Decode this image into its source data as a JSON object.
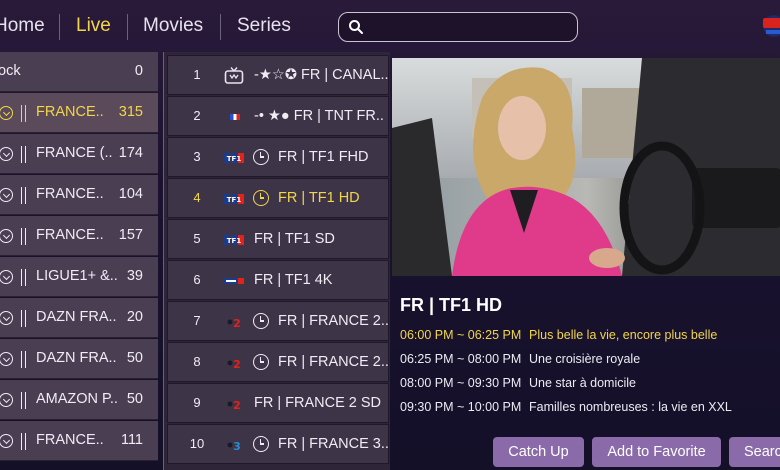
{
  "nav": {
    "tabs": [
      {
        "label": "Home"
      },
      {
        "label": "Live"
      },
      {
        "label": "Movies"
      },
      {
        "label": "Series"
      }
    ],
    "active_tab": "Live",
    "search": {
      "value": "",
      "placeholder": ""
    }
  },
  "categories": [
    {
      "name": "ock",
      "count": "0"
    },
    {
      "name": "FRANCE..",
      "count": "315"
    },
    {
      "name": "FRANCE (..",
      "count": "174"
    },
    {
      "name": "FRANCE..",
      "count": "104"
    },
    {
      "name": "FRANCE..",
      "count": "157"
    },
    {
      "name": "LIGUE1+ &..",
      "count": "39"
    },
    {
      "name": "DAZN FRA..",
      "count": "20"
    },
    {
      "name": "DAZN FRA..",
      "count": "50"
    },
    {
      "name": "AMAZON P..",
      "count": "50"
    },
    {
      "name": "FRANCE..",
      "count": "111"
    }
  ],
  "channels": [
    {
      "num": "1",
      "name": "-★☆✪ FR | CANAL..",
      "has_catchup": false,
      "logo": "tv-icon"
    },
    {
      "num": "2",
      "name": "-• ★● FR | TNT FR..",
      "has_catchup": false,
      "logo": "france-flag-icon"
    },
    {
      "num": "3",
      "name": "FR | TF1 FHD",
      "has_catchup": true,
      "logo": "tf1-logo"
    },
    {
      "num": "4",
      "name": "FR | TF1 HD",
      "has_catchup": true,
      "logo": "tf1-logo"
    },
    {
      "num": "5",
      "name": "FR | TF1 SD",
      "has_catchup": false,
      "logo": "tf1-logo"
    },
    {
      "num": "6",
      "name": "FR | TF1 4K",
      "has_catchup": false,
      "logo": "tf1-4k-logo"
    },
    {
      "num": "7",
      "name": "FR | FRANCE 2..",
      "has_catchup": true,
      "logo": "france2-logo"
    },
    {
      "num": "8",
      "name": "FR | FRANCE 2..",
      "has_catchup": true,
      "logo": "france2-logo"
    },
    {
      "num": "9",
      "name": "FR | FRANCE 2 SD",
      "has_catchup": false,
      "logo": "france2-logo"
    },
    {
      "num": "10",
      "name": "FR | FRANCE 3..",
      "has_catchup": true,
      "logo": "france3-logo"
    }
  ],
  "selected_channel": "4",
  "player": {
    "channel_title": "FR | TF1 HD",
    "epg": [
      {
        "time": "06:00 PM ~ 06:25 PM",
        "title": "Plus belle la vie, encore plus belle",
        "current": true
      },
      {
        "time": "06:25 PM ~ 08:00 PM",
        "title": "Une croisière royale",
        "current": false
      },
      {
        "time": "08:00 PM ~ 09:30 PM",
        "title": "Une star à domicile",
        "current": false
      },
      {
        "time": "09:30 PM ~ 10:00 PM",
        "title": "Familles nombreuses : la vie en XXL",
        "current": false
      }
    ]
  },
  "actions": {
    "catch_up": "Catch Up",
    "add_favorite": "Add to Favorite",
    "search": "Searc"
  },
  "colors": {
    "accent_yellow": "#f2d64a",
    "button_purple": "#8a6aa8",
    "tf1_red": "#e2231a",
    "tf1_blue": "#1a3c8c"
  }
}
